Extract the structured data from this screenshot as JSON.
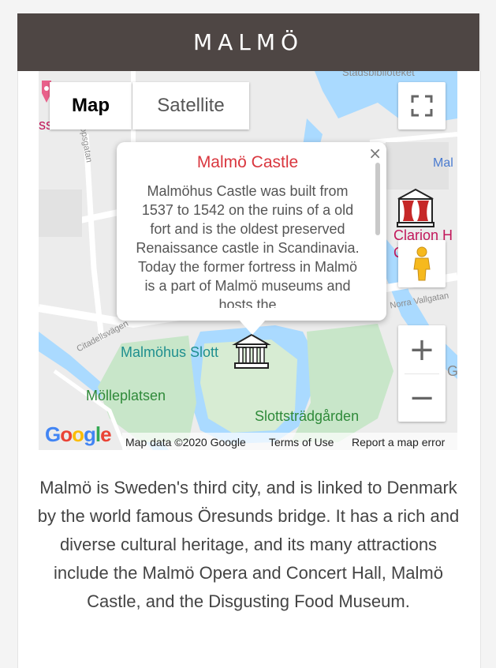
{
  "header": {
    "title": "MALMÖ"
  },
  "map": {
    "type_controls": {
      "map_label": "Map",
      "satellite_label": "Satellite"
    },
    "info_window": {
      "title": "Malmö Castle",
      "text": "Malmöhus Castle was built from 1537 to 1542 on the ruins of a old fort and is the oldest preserved Renaissance castle in Scandinavia. Today the former fortress in Malmö is a part of Malmö museums and hosts the",
      "close": "×"
    },
    "labels": {
      "castle": "Malmöhus Slott",
      "park1": "Mölleplatsen",
      "park2": "Slottsträdgården",
      "clarion": "Clarion H",
      "clarion2": "C",
      "mal": "Mal",
      "street1": "Citadellsvägen",
      "street2": "Norra Vallgatan",
      "street3": "opsgatan",
      "top_street": "Stadsbiblioteket",
      "left_poi": "ssen",
      "g_frag": "G",
      "gy_frag": "Gy"
    },
    "zoom": {
      "in": "+",
      "out": "−"
    },
    "attribution": {
      "logo": "Google",
      "data": "Map data ©2020 Google",
      "terms": "Terms of Use",
      "report": "Report a map error"
    },
    "icons": [
      "fullscreen-icon",
      "pegman-icon",
      "castle-marker-icon",
      "theatre-marker-icon",
      "red-pin-icon"
    ]
  },
  "description": "Malmö is Sweden's third city, and is linked to Denmark by the world famous Öresunds bridge. It has a rich and diverse cultural heritage, and its many attractions include the Malmö Opera and Concert Hall, Malmö Castle, and the Disgusting Food Museum."
}
